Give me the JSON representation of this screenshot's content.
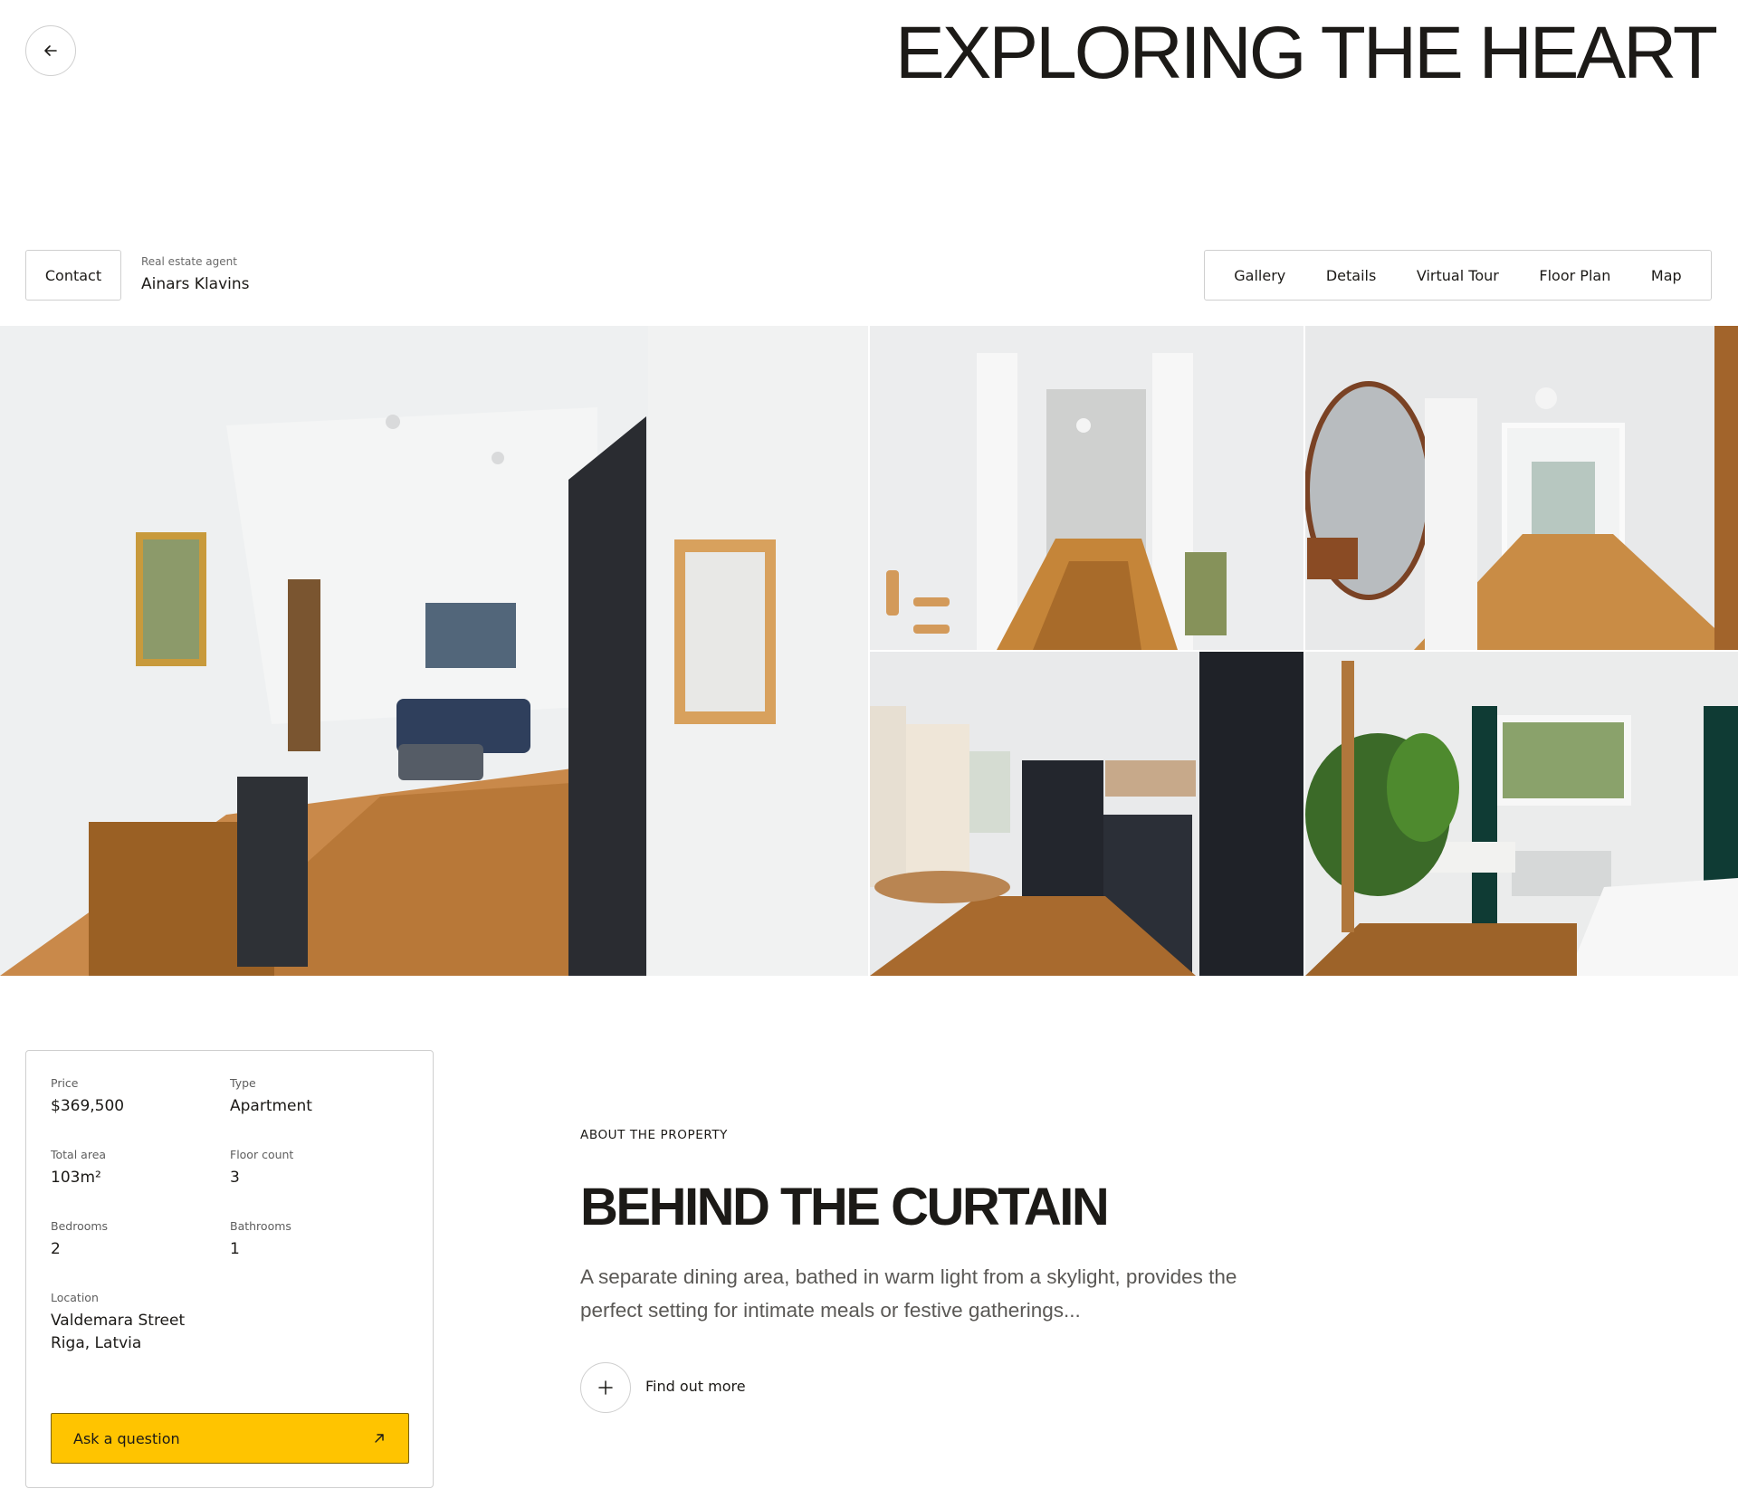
{
  "header": {
    "back_icon": "arrow-left-icon",
    "title": "EXPLORING THE HEART"
  },
  "agent": {
    "contact_label": "Contact",
    "caption": "Real estate agent",
    "name": "Ainars Klavins"
  },
  "tabs": [
    {
      "label": "Gallery"
    },
    {
      "label": "Details"
    },
    {
      "label": "Virtual Tour"
    },
    {
      "label": "Floor Plan"
    },
    {
      "label": "Map"
    }
  ],
  "gallery": {
    "photos": [
      "living-room-photo",
      "hallway-photo",
      "mirror-hallway-photo",
      "kitchen-photo",
      "bedroom-photo"
    ]
  },
  "details": {
    "price_label": "Price",
    "price_value": "$369,500",
    "type_label": "Type",
    "type_value": "Apartment",
    "area_label": "Total area",
    "area_value": "103m²",
    "floor_label": "Floor count",
    "floor_value": "3",
    "bedrooms_label": "Bedrooms",
    "bedrooms_value": "2",
    "bathrooms_label": "Bathrooms",
    "bathrooms_value": "1",
    "location_label": "Location",
    "location_line1": "Valdemara Street",
    "location_line2": "Riga, Latvia"
  },
  "cta": {
    "ask_label": "Ask a question",
    "ask_icon": "arrow-up-right-icon"
  },
  "about": {
    "kicker": "ABOUT THE PROPERTY",
    "title": "BEHIND THE CURTAIN",
    "body": "A separate dining area, bathed in warm light from a skylight, provides the perfect setting for intimate meals or festive gatherings...",
    "more_label": "Find out more",
    "more_icon": "plus-icon"
  },
  "colors": {
    "accent": "#ffc400",
    "text": "#1c1a17",
    "border": "#cfcfcf"
  }
}
